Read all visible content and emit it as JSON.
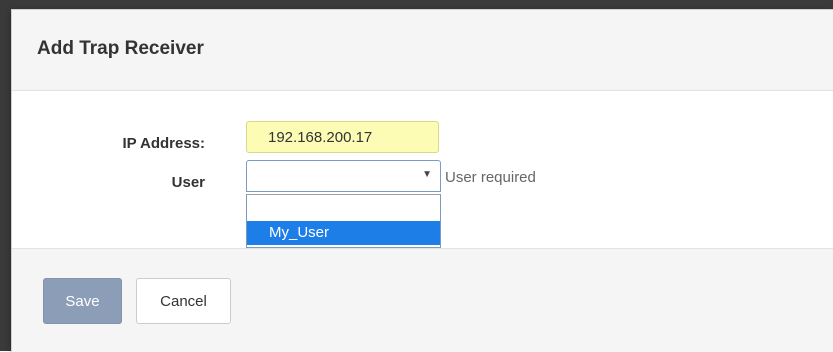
{
  "dialog": {
    "title": "Add Trap Receiver"
  },
  "form": {
    "ip_address": {
      "label": "IP Address:",
      "value": "192.168.200.17"
    },
    "user": {
      "label": "User",
      "selected_value": "",
      "validation_message": "User required",
      "options": [
        "",
        "My_User"
      ],
      "highlighted_option": "My_User"
    }
  },
  "footer": {
    "save_label": "Save",
    "cancel_label": "Cancel"
  },
  "icons": {
    "select_arrow": "▼"
  }
}
